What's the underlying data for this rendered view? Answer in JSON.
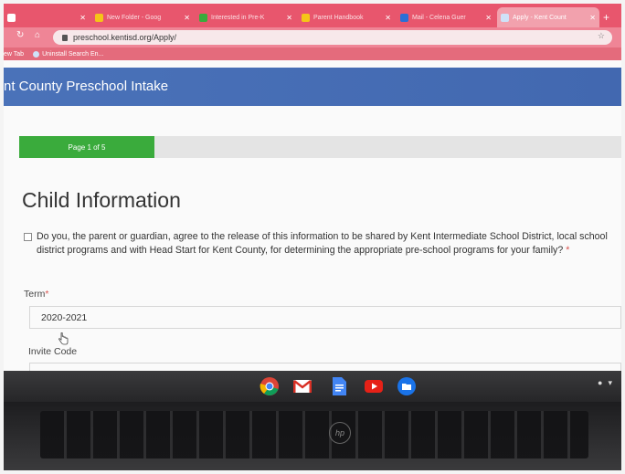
{
  "browser": {
    "tabs": [
      {
        "title": "",
        "fav": "#ffffff",
        "active": false
      },
      {
        "title": "New Folder - Goog",
        "fav": "#f5c518",
        "active": false
      },
      {
        "title": "Interested in Pre-K",
        "fav": "#3aab3c",
        "active": false
      },
      {
        "title": "Parent Handbook",
        "fav": "#f5c518",
        "active": false
      },
      {
        "title": "Mail - Celena Guer",
        "fav": "#2b6fd6",
        "active": false
      },
      {
        "title": "Apply - Kent Count",
        "fav": "#cfe2f8",
        "active": true
      }
    ],
    "url": "preschool.kentisd.org/Apply/",
    "bookmarks": [
      {
        "label": "ew Tab"
      },
      {
        "label": "Uninstall Search En..."
      }
    ]
  },
  "site": {
    "title": "nt County Preschool Intake"
  },
  "progress": {
    "label": "Page 1 of 5",
    "fraction": 0.2
  },
  "form": {
    "section_title": "Child Information",
    "consent_text": "Do you, the parent or guardian, agree to the release of this information to be shared by Kent Intermediate School District, local school district programs and with Head Start for Kent County, for determining the appropriate pre-school programs for your family?",
    "required_mark": "*",
    "term_label": "Term",
    "term_value": "2020-2021",
    "invite_label": "Invite Code"
  },
  "shelf": {
    "apps": [
      {
        "name": "chrome-icon"
      },
      {
        "name": "gmail-icon"
      },
      {
        "name": "docs-icon"
      },
      {
        "name": "youtube-icon"
      },
      {
        "name": "files-icon"
      }
    ],
    "brand": "hp"
  }
}
